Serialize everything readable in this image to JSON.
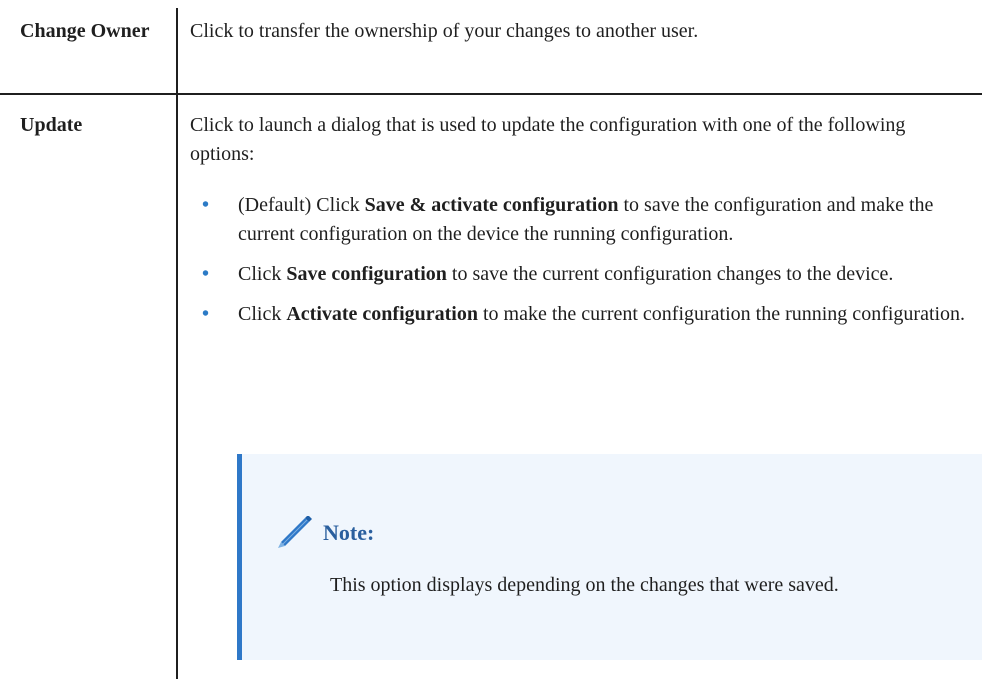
{
  "rows": [
    {
      "term": "Change Owner",
      "description": "Click to transfer the ownership of your changes to another user."
    },
    {
      "term": "Update",
      "description": "Click to launch a dialog that is used to update the configuration with one of the following options:",
      "options": [
        {
          "bullet": "•",
          "prefix": "(Default) Click ",
          "bold": "Save & activate configuration",
          "suffix": " to save the configuration and make the current configuration on the device the running configuration."
        },
        {
          "bullet": "•",
          "prefix": "Click ",
          "bold": "Save configuration",
          "suffix": " to save the current configuration changes to the device."
        },
        {
          "bullet": "•",
          "prefix": "Click ",
          "bold": "Activate configuration",
          "suffix": " to make the current configuration the running configuration."
        }
      ],
      "note": {
        "icon": "pencil-icon",
        "title": "Note:",
        "text": "This option displays depending on the changes that were saved."
      }
    }
  ],
  "colors": {
    "text": "#1f1f1f",
    "bullet": "#2c7bc6",
    "note_border": "#2f78c8",
    "note_bg": "#f0f6fd",
    "note_title": "#2a5f9e"
  }
}
